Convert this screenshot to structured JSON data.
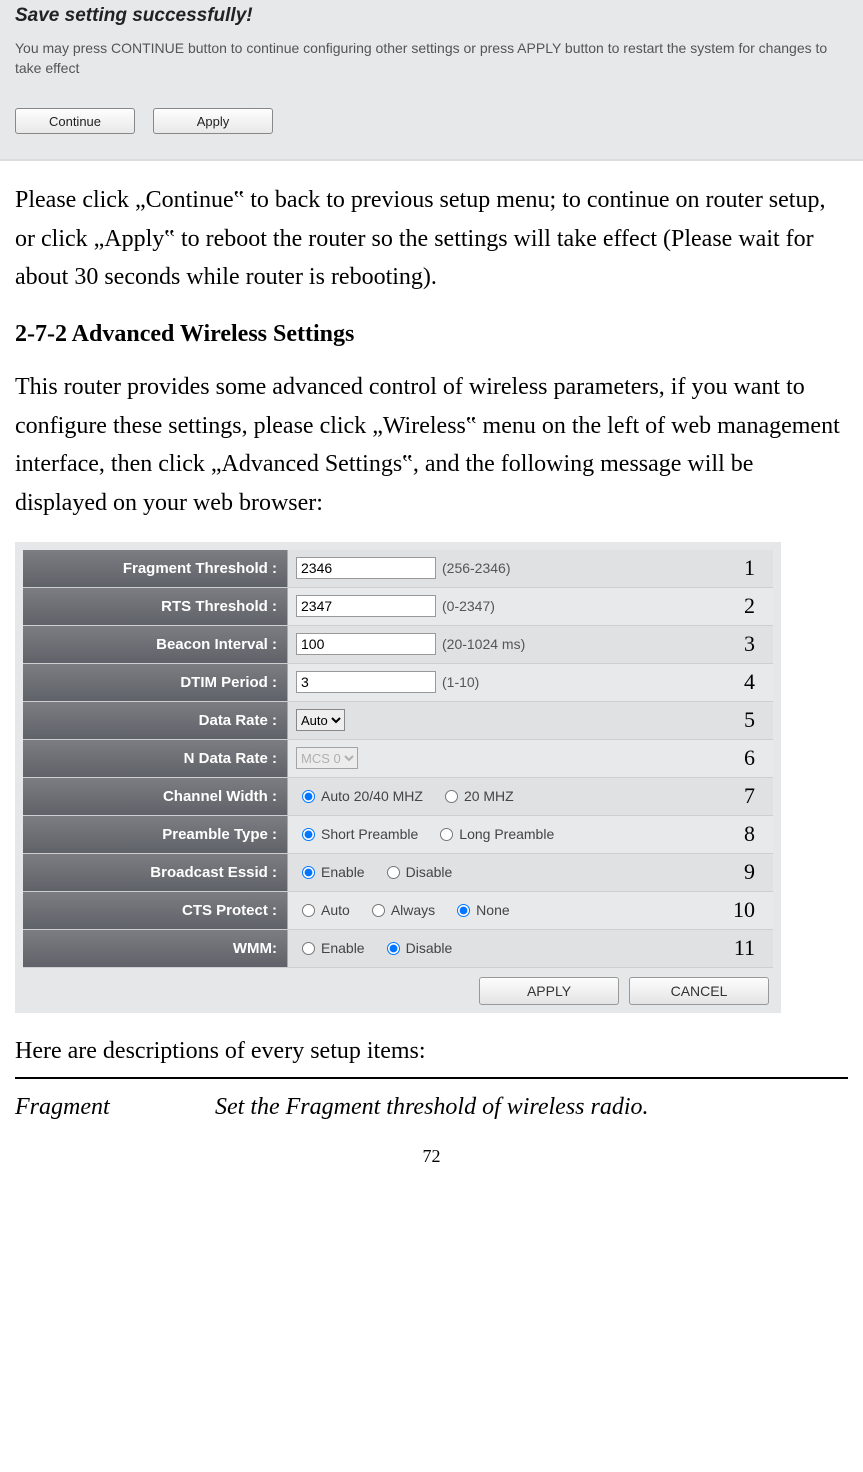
{
  "dialog": {
    "title": "Save setting successfully!",
    "subtext": "You may press CONTINUE button to continue configuring other settings or press APPLY button to restart the system for changes to take effect",
    "continue_btn": "Continue",
    "apply_btn": "Apply"
  },
  "paragraph1": "Please click „Continue‟ to back to previous setup menu; to continue on router setup, or click „Apply‟ to reboot the router so the settings will take effect (Please wait for about 30 seconds while router is rebooting).",
  "section_heading": "2-7-2 Advanced Wireless Settings",
  "paragraph2": "This router provides some advanced control of wireless parameters, if you want to configure these settings, please click „Wireless‟ menu on the left of web management interface, then click „Advanced Settings‟, and the following message will be displayed on your web browser:",
  "settings": {
    "rows": [
      {
        "label": "Fragment Threshold :",
        "type": "text",
        "value": "2346",
        "hint": "(256-2346)",
        "annot": "1"
      },
      {
        "label": "RTS Threshold :",
        "type": "text",
        "value": "2347",
        "hint": "(0-2347)",
        "annot": "2"
      },
      {
        "label": "Beacon Interval :",
        "type": "text",
        "value": "100",
        "hint": "(20-1024 ms)",
        "annot": "3"
      },
      {
        "label": "DTIM Period :",
        "type": "text",
        "value": "3",
        "hint": "(1-10)",
        "annot": "4"
      },
      {
        "label": "Data Rate :",
        "type": "select",
        "value": "Auto",
        "annot": "5"
      },
      {
        "label": "N Data Rate :",
        "type": "select-disabled",
        "value": "MCS 0",
        "annot": "6"
      },
      {
        "label": "Channel Width :",
        "type": "radio",
        "options": [
          {
            "t": "Auto 20/40 MHZ",
            "c": true
          },
          {
            "t": "20 MHZ",
            "c": false
          }
        ],
        "annot": "7"
      },
      {
        "label": "Preamble Type :",
        "type": "radio",
        "options": [
          {
            "t": "Short Preamble",
            "c": true
          },
          {
            "t": "Long Preamble",
            "c": false
          }
        ],
        "annot": "8"
      },
      {
        "label": "Broadcast Essid :",
        "type": "radio",
        "options": [
          {
            "t": "Enable",
            "c": true
          },
          {
            "t": "Disable",
            "c": false
          }
        ],
        "annot": "9"
      },
      {
        "label": "CTS Protect :",
        "type": "radio",
        "options": [
          {
            "t": "Auto",
            "c": false
          },
          {
            "t": "Always",
            "c": false
          },
          {
            "t": "None",
            "c": true
          }
        ],
        "annot": "10"
      },
      {
        "label": "WMM:",
        "type": "radio",
        "options": [
          {
            "t": "Enable",
            "c": false
          },
          {
            "t": "Disable",
            "c": true
          }
        ],
        "annot": "11"
      }
    ],
    "apply_btn": "APPLY",
    "cancel_btn": "CANCEL"
  },
  "desc_intro": "Here are descriptions of every setup items:",
  "desc_item": {
    "term": "Fragment",
    "def": "Set the Fragment threshold of wireless radio."
  },
  "page_number": "72"
}
